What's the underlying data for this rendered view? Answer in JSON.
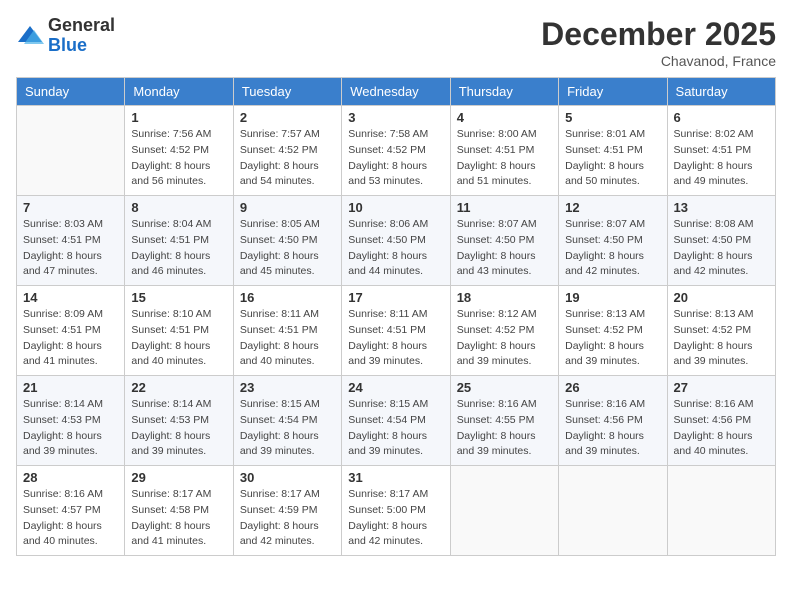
{
  "header": {
    "logo": {
      "general": "General",
      "blue": "Blue"
    },
    "title": "December 2025",
    "location": "Chavanod, France"
  },
  "weekdays": [
    "Sunday",
    "Monday",
    "Tuesday",
    "Wednesday",
    "Thursday",
    "Friday",
    "Saturday"
  ],
  "weeks": [
    [
      {
        "day": "",
        "sunrise": "",
        "sunset": "",
        "daylight": ""
      },
      {
        "day": "1",
        "sunrise": "Sunrise: 7:56 AM",
        "sunset": "Sunset: 4:52 PM",
        "daylight": "Daylight: 8 hours and 56 minutes."
      },
      {
        "day": "2",
        "sunrise": "Sunrise: 7:57 AM",
        "sunset": "Sunset: 4:52 PM",
        "daylight": "Daylight: 8 hours and 54 minutes."
      },
      {
        "day": "3",
        "sunrise": "Sunrise: 7:58 AM",
        "sunset": "Sunset: 4:52 PM",
        "daylight": "Daylight: 8 hours and 53 minutes."
      },
      {
        "day": "4",
        "sunrise": "Sunrise: 8:00 AM",
        "sunset": "Sunset: 4:51 PM",
        "daylight": "Daylight: 8 hours and 51 minutes."
      },
      {
        "day": "5",
        "sunrise": "Sunrise: 8:01 AM",
        "sunset": "Sunset: 4:51 PM",
        "daylight": "Daylight: 8 hours and 50 minutes."
      },
      {
        "day": "6",
        "sunrise": "Sunrise: 8:02 AM",
        "sunset": "Sunset: 4:51 PM",
        "daylight": "Daylight: 8 hours and 49 minutes."
      }
    ],
    [
      {
        "day": "7",
        "sunrise": "Sunrise: 8:03 AM",
        "sunset": "Sunset: 4:51 PM",
        "daylight": "Daylight: 8 hours and 47 minutes."
      },
      {
        "day": "8",
        "sunrise": "Sunrise: 8:04 AM",
        "sunset": "Sunset: 4:51 PM",
        "daylight": "Daylight: 8 hours and 46 minutes."
      },
      {
        "day": "9",
        "sunrise": "Sunrise: 8:05 AM",
        "sunset": "Sunset: 4:50 PM",
        "daylight": "Daylight: 8 hours and 45 minutes."
      },
      {
        "day": "10",
        "sunrise": "Sunrise: 8:06 AM",
        "sunset": "Sunset: 4:50 PM",
        "daylight": "Daylight: 8 hours and 44 minutes."
      },
      {
        "day": "11",
        "sunrise": "Sunrise: 8:07 AM",
        "sunset": "Sunset: 4:50 PM",
        "daylight": "Daylight: 8 hours and 43 minutes."
      },
      {
        "day": "12",
        "sunrise": "Sunrise: 8:07 AM",
        "sunset": "Sunset: 4:50 PM",
        "daylight": "Daylight: 8 hours and 42 minutes."
      },
      {
        "day": "13",
        "sunrise": "Sunrise: 8:08 AM",
        "sunset": "Sunset: 4:50 PM",
        "daylight": "Daylight: 8 hours and 42 minutes."
      }
    ],
    [
      {
        "day": "14",
        "sunrise": "Sunrise: 8:09 AM",
        "sunset": "Sunset: 4:51 PM",
        "daylight": "Daylight: 8 hours and 41 minutes."
      },
      {
        "day": "15",
        "sunrise": "Sunrise: 8:10 AM",
        "sunset": "Sunset: 4:51 PM",
        "daylight": "Daylight: 8 hours and 40 minutes."
      },
      {
        "day": "16",
        "sunrise": "Sunrise: 8:11 AM",
        "sunset": "Sunset: 4:51 PM",
        "daylight": "Daylight: 8 hours and 40 minutes."
      },
      {
        "day": "17",
        "sunrise": "Sunrise: 8:11 AM",
        "sunset": "Sunset: 4:51 PM",
        "daylight": "Daylight: 8 hours and 39 minutes."
      },
      {
        "day": "18",
        "sunrise": "Sunrise: 8:12 AM",
        "sunset": "Sunset: 4:52 PM",
        "daylight": "Daylight: 8 hours and 39 minutes."
      },
      {
        "day": "19",
        "sunrise": "Sunrise: 8:13 AM",
        "sunset": "Sunset: 4:52 PM",
        "daylight": "Daylight: 8 hours and 39 minutes."
      },
      {
        "day": "20",
        "sunrise": "Sunrise: 8:13 AM",
        "sunset": "Sunset: 4:52 PM",
        "daylight": "Daylight: 8 hours and 39 minutes."
      }
    ],
    [
      {
        "day": "21",
        "sunrise": "Sunrise: 8:14 AM",
        "sunset": "Sunset: 4:53 PM",
        "daylight": "Daylight: 8 hours and 39 minutes."
      },
      {
        "day": "22",
        "sunrise": "Sunrise: 8:14 AM",
        "sunset": "Sunset: 4:53 PM",
        "daylight": "Daylight: 8 hours and 39 minutes."
      },
      {
        "day": "23",
        "sunrise": "Sunrise: 8:15 AM",
        "sunset": "Sunset: 4:54 PM",
        "daylight": "Daylight: 8 hours and 39 minutes."
      },
      {
        "day": "24",
        "sunrise": "Sunrise: 8:15 AM",
        "sunset": "Sunset: 4:54 PM",
        "daylight": "Daylight: 8 hours and 39 minutes."
      },
      {
        "day": "25",
        "sunrise": "Sunrise: 8:16 AM",
        "sunset": "Sunset: 4:55 PM",
        "daylight": "Daylight: 8 hours and 39 minutes."
      },
      {
        "day": "26",
        "sunrise": "Sunrise: 8:16 AM",
        "sunset": "Sunset: 4:56 PM",
        "daylight": "Daylight: 8 hours and 39 minutes."
      },
      {
        "day": "27",
        "sunrise": "Sunrise: 8:16 AM",
        "sunset": "Sunset: 4:56 PM",
        "daylight": "Daylight: 8 hours and 40 minutes."
      }
    ],
    [
      {
        "day": "28",
        "sunrise": "Sunrise: 8:16 AM",
        "sunset": "Sunset: 4:57 PM",
        "daylight": "Daylight: 8 hours and 40 minutes."
      },
      {
        "day": "29",
        "sunrise": "Sunrise: 8:17 AM",
        "sunset": "Sunset: 4:58 PM",
        "daylight": "Daylight: 8 hours and 41 minutes."
      },
      {
        "day": "30",
        "sunrise": "Sunrise: 8:17 AM",
        "sunset": "Sunset: 4:59 PM",
        "daylight": "Daylight: 8 hours and 42 minutes."
      },
      {
        "day": "31",
        "sunrise": "Sunrise: 8:17 AM",
        "sunset": "Sunset: 5:00 PM",
        "daylight": "Daylight: 8 hours and 42 minutes."
      },
      {
        "day": "",
        "sunrise": "",
        "sunset": "",
        "daylight": ""
      },
      {
        "day": "",
        "sunrise": "",
        "sunset": "",
        "daylight": ""
      },
      {
        "day": "",
        "sunrise": "",
        "sunset": "",
        "daylight": ""
      }
    ]
  ]
}
